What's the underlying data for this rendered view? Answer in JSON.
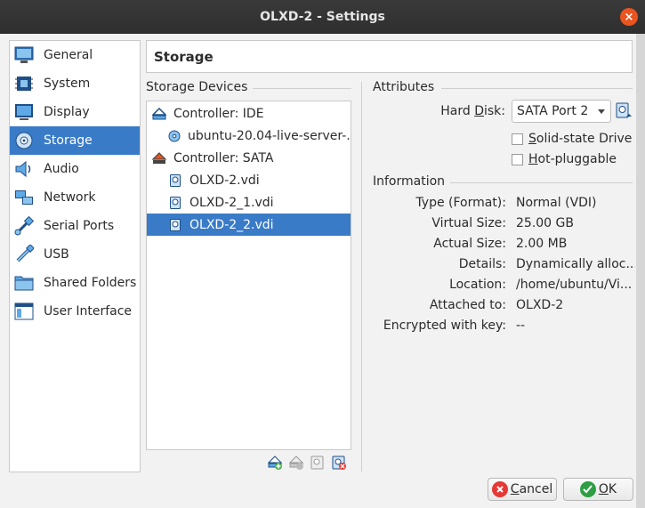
{
  "window": {
    "title": "OLXD-2 - Settings",
    "close_glyph": "×"
  },
  "sidebar": {
    "items": [
      {
        "label": "General",
        "icon": "general-icon"
      },
      {
        "label": "System",
        "icon": "system-icon"
      },
      {
        "label": "Display",
        "icon": "display-icon"
      },
      {
        "label": "Storage",
        "icon": "storage-icon",
        "selected": true
      },
      {
        "label": "Audio",
        "icon": "audio-icon"
      },
      {
        "label": "Network",
        "icon": "network-icon"
      },
      {
        "label": "Serial Ports",
        "icon": "serial-ports-icon"
      },
      {
        "label": "USB",
        "icon": "usb-icon"
      },
      {
        "label": "Shared Folders",
        "icon": "shared-folders-icon"
      },
      {
        "label": "User Interface",
        "icon": "user-interface-icon"
      }
    ]
  },
  "page": {
    "title": "Storage"
  },
  "storage_devices": {
    "title": "Storage Devices",
    "tree": [
      {
        "label": "Controller: IDE",
        "type": "controller"
      },
      {
        "label": "ubuntu-20.04-live-server-...",
        "type": "optical"
      },
      {
        "label": "Controller: SATA",
        "type": "controller"
      },
      {
        "label": "OLXD-2.vdi",
        "type": "disk"
      },
      {
        "label": "OLXD-2_1.vdi",
        "type": "disk"
      },
      {
        "label": "OLXD-2_2.vdi",
        "type": "disk",
        "selected": true
      }
    ]
  },
  "attributes": {
    "title": "Attributes",
    "hard_disk_label_pre": "Hard ",
    "hard_disk_label_mnemonic": "D",
    "hard_disk_label_post": "isk:",
    "hard_disk_value": "SATA Port 2",
    "ssd_mnemonic": "S",
    "ssd_rest": "olid-state Drive",
    "hotplug_mnemonic": "H",
    "hotplug_rest": "ot-pluggable"
  },
  "information": {
    "title": "Information",
    "rows": [
      {
        "label": "Type (Format):",
        "value": "Normal (VDI)"
      },
      {
        "label": "Virtual Size:",
        "value": "25.00 GB"
      },
      {
        "label": "Actual Size:",
        "value": "2.00 MB"
      },
      {
        "label": "Details:",
        "value": "Dynamically alloc..."
      },
      {
        "label": "Location:",
        "value": "/home/ubuntu/Vi..."
      },
      {
        "label": "Attached to:",
        "value": "OLXD-2"
      },
      {
        "label": "Encrypted with key:",
        "value": "--"
      }
    ]
  },
  "buttons": {
    "cancel_mnemonic": "C",
    "cancel_rest": "ancel",
    "ok_mnemonic": "O",
    "ok_rest": "K"
  },
  "colors": {
    "selection": "#3a7bc8",
    "titlebar": "#333333",
    "close": "#e95420"
  }
}
